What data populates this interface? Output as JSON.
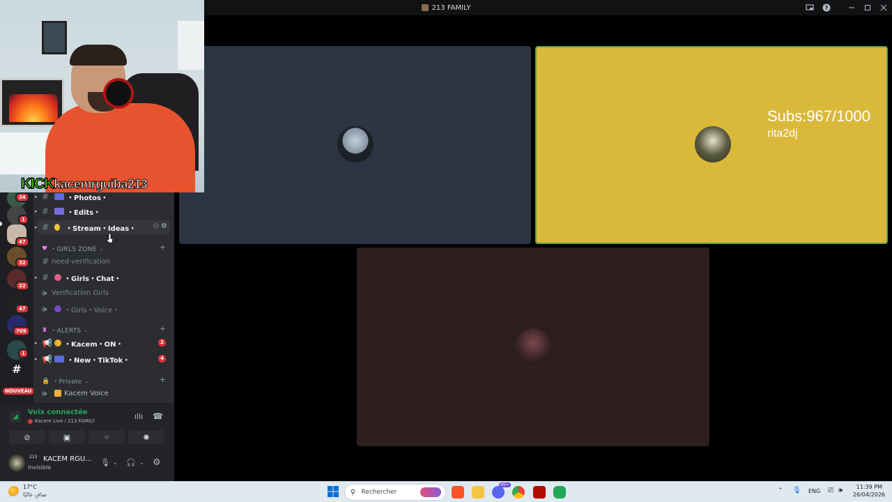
{
  "window": {
    "title": "213 FAMILY",
    "controls": [
      "screen-icon",
      "help-icon",
      "minimize-icon",
      "maximize-icon",
      "close-icon"
    ]
  },
  "stream_overlay": {
    "brand": "KICK",
    "handle": "kacemrguiba213"
  },
  "server_rail": {
    "badges": [
      "24",
      "1",
      "47",
      "32",
      "22",
      "47",
      "709",
      "1"
    ],
    "new_label": "NOUVEAU"
  },
  "channels": {
    "items": [
      {
        "label": "・Photos・",
        "type": "text"
      },
      {
        "label": "・Edits・",
        "type": "text"
      },
      {
        "label": "・Stream・Ideas・",
        "type": "text"
      }
    ],
    "girls_zone": {
      "category": "・GIRLS ZONE",
      "items": [
        {
          "label": "need-verification"
        },
        {
          "label": "・Girls・Chat・"
        },
        {
          "label": "Verification Girls"
        },
        {
          "label": "・Girls・Voice・"
        }
      ]
    },
    "alerts": {
      "category": "・ALERTS",
      "items": [
        {
          "label": "・Kacem・ON・",
          "badge": "2"
        },
        {
          "label": "・New・TikTok・",
          "badge": "4"
        }
      ]
    },
    "private": {
      "category": "・Private",
      "items": [
        {
          "label": "Kacem Voice"
        }
      ]
    }
  },
  "voice": {
    "status": "Voix connectée",
    "location": "Kacem Live / 213 FAMILY"
  },
  "user": {
    "name": "KACEM RGU...",
    "status": "Invisible",
    "avatar_tag": "213"
  },
  "tiles": {
    "tile2": {
      "overlay_line1": "Subs:967/1000",
      "overlay_line2": "rita2dj"
    }
  },
  "colors": {
    "tile1": "#2b3544",
    "tile2": "#dab93a",
    "tile2_border": "#5ba34a",
    "tile3": "#2c1f1e",
    "kick_green": "#53fc18",
    "connected_green": "#23a55a"
  },
  "taskbar": {
    "weather_temp": "17°C",
    "weather_desc": "صافٍ غالبًا",
    "search_placeholder": "Rechercher",
    "lang": "ENG",
    "time": "11:39 PM",
    "date": "26/04/2026",
    "discord_badge": "99+"
  }
}
